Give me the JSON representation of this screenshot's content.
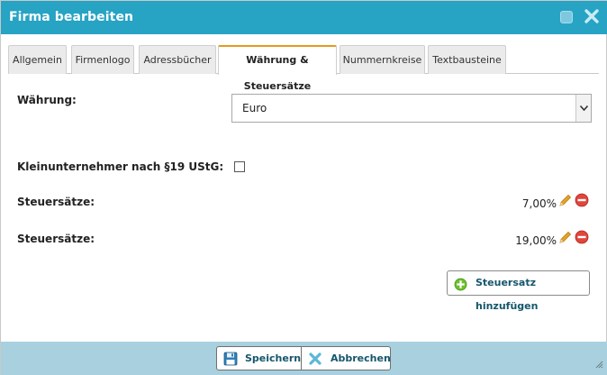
{
  "window": {
    "title": "Firma bearbeiten"
  },
  "tabs": [
    {
      "label": "Allgemein",
      "active": false
    },
    {
      "label": "Firmenlogo",
      "active": false
    },
    {
      "label": "Adressbücher",
      "active": false
    },
    {
      "label": "Währung & Steuersätze",
      "active": true
    },
    {
      "label": "Nummernkreise",
      "active": false
    },
    {
      "label": "Textbausteine",
      "active": false
    }
  ],
  "form": {
    "currency_label": "Währung:",
    "currency_value": "Euro",
    "small_business_label": "Kleinunternehmer nach §19 UStG:",
    "small_business_checked": false,
    "tax_rates": [
      {
        "label": "Steuersätze:",
        "value": "7,00%"
      },
      {
        "label": "Steuersätze:",
        "value": "19,00%"
      }
    ],
    "add_tax_rate_label": "Steuersatz hinzufügen"
  },
  "footer": {
    "save_label": "Speichern",
    "cancel_label": "Abbrechen"
  },
  "colors": {
    "titlebar": "#27a3c4",
    "footer": "#a8d0de",
    "active_tab_accent": "#e39b1a",
    "button_text": "#15566b",
    "delete_icon": "#e0463c",
    "add_icon": "#6cbf2e",
    "edit_icon": "#e4a32a"
  },
  "icons": {
    "maximize": "maximize-icon",
    "close": "close-icon",
    "edit": "pencil-icon",
    "delete": "minus-circle-icon",
    "add": "plus-circle-icon",
    "save": "floppy-disk-icon",
    "cancel": "x-icon"
  }
}
